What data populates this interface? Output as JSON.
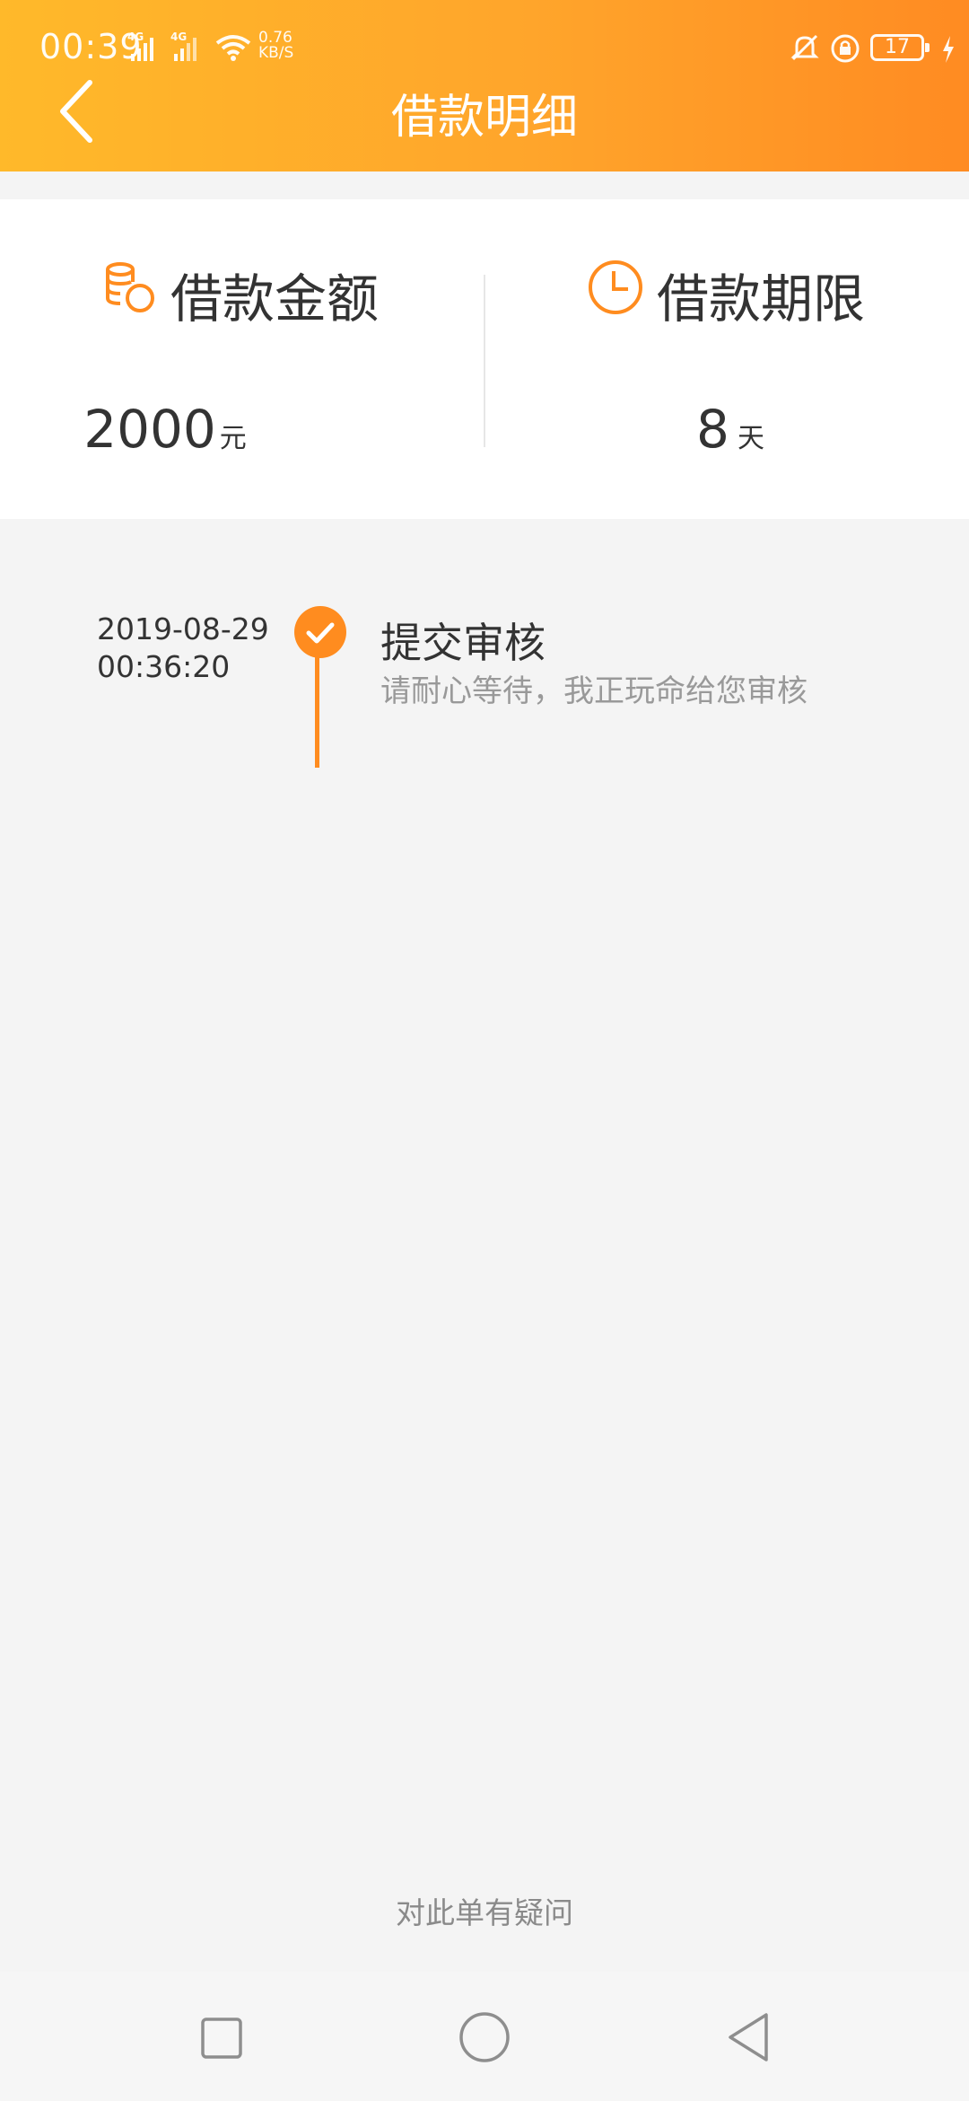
{
  "status_bar": {
    "time": "00:39",
    "network_1": "4G",
    "network_2": "4G",
    "speed_value": "0.76",
    "speed_unit": "KB/S",
    "battery_level": "17",
    "icons": [
      "signal-icon",
      "wifi-icon",
      "alarm-icon",
      "rotation-lock-icon",
      "battery-icon",
      "charging-icon"
    ]
  },
  "header": {
    "title": "借款明细",
    "back_icon": "chevron-left-icon",
    "colors": {
      "gradient_start": "#ffb92a",
      "gradient_end": "#ff8b22"
    }
  },
  "summary": {
    "amount": {
      "label": "借款金额",
      "value": "2000",
      "unit": "元",
      "icon": "coins-icon"
    },
    "term": {
      "label": "借款期限",
      "value": "8",
      "unit": "天",
      "icon": "clock-icon"
    }
  },
  "timeline": [
    {
      "date": "2019-08-29",
      "time": "00:36:20",
      "title": "提交审核",
      "description": "请耐心等待，我正玩命给您审核",
      "status": "done",
      "accent": "#ff8c1f"
    }
  ],
  "footer": {
    "question_link": "对此单有疑问"
  },
  "system_nav": {
    "buttons": [
      "recent-apps-icon",
      "home-icon",
      "back-triangle-icon"
    ]
  }
}
